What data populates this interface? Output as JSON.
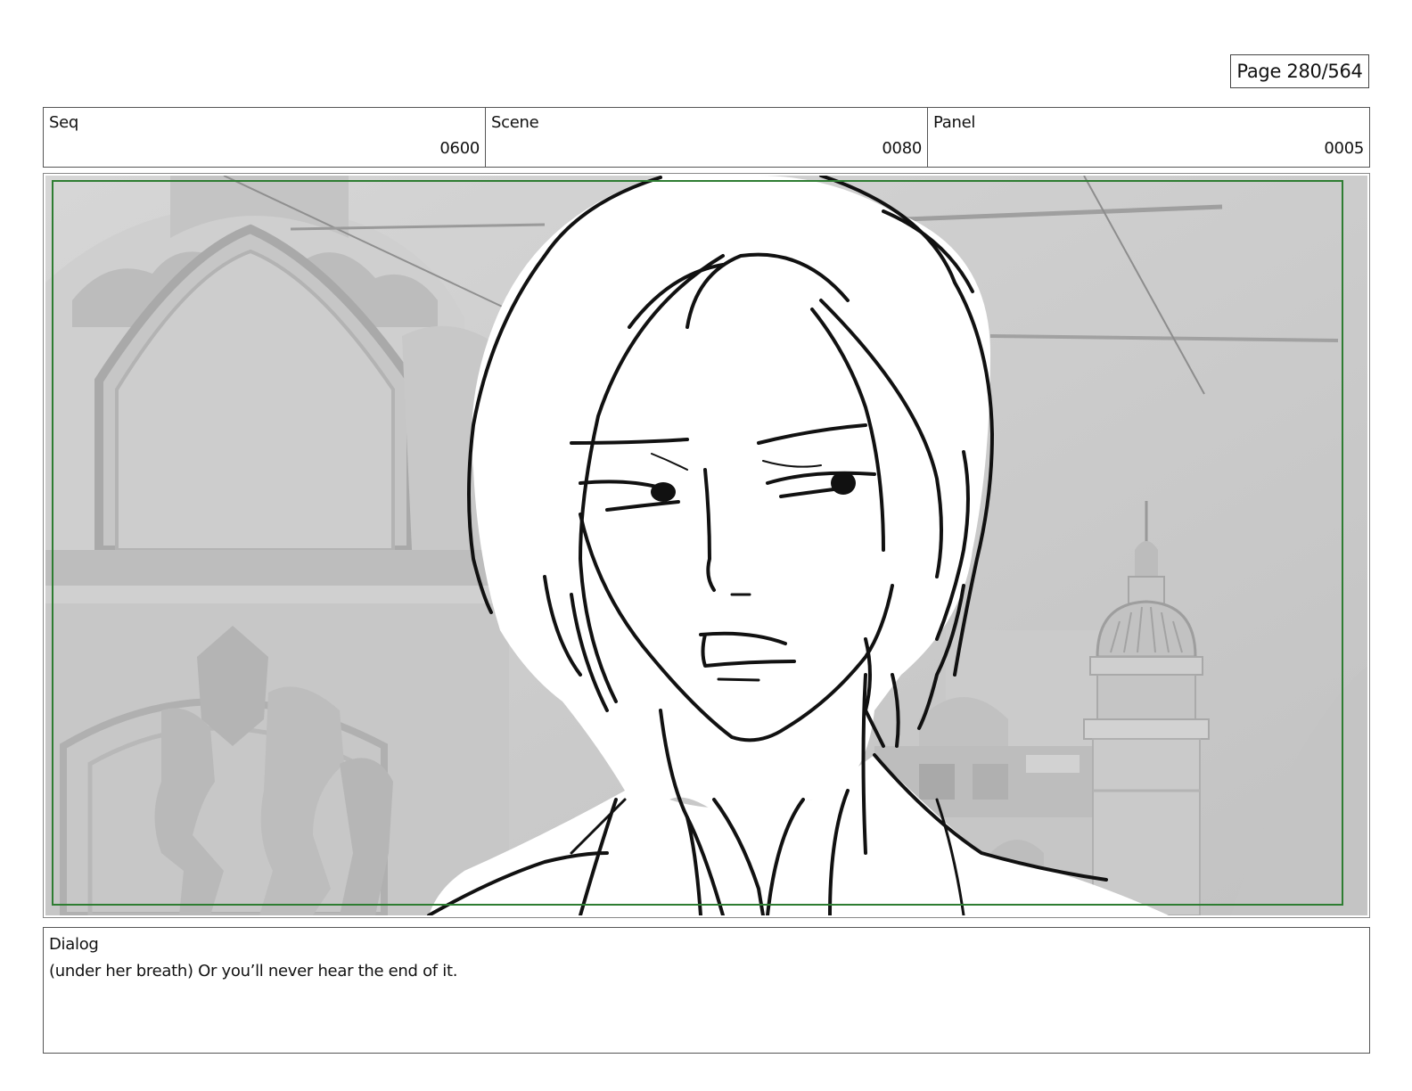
{
  "page": {
    "label": "Page 280/564"
  },
  "header": {
    "seq_label": "Seq",
    "seq_value": "0600",
    "scene_label": "Scene",
    "scene_value": "0080",
    "panel_label": "Panel",
    "panel_value": "0005"
  },
  "dialog": {
    "label": "Dialog",
    "text": "(under her breath) Or you’ll never hear the end of it."
  },
  "colors": {
    "safe_frame": "#2e7d32",
    "background_render": "#c9c9c9",
    "sketch_line": "#111111"
  }
}
